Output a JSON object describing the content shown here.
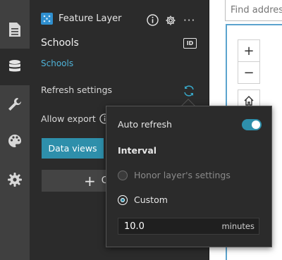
{
  "layer": {
    "type_label": "Feature Layer",
    "name": "Schools",
    "link": "Schools"
  },
  "settings": {
    "refresh_label": "Refresh settings",
    "allow_export_label": "Allow export",
    "data_views_label": "Data views",
    "create_button_label": "C"
  },
  "popover": {
    "auto_refresh_label": "Auto refresh",
    "auto_refresh_on": true,
    "interval_heading": "Interval",
    "options": [
      {
        "label": "Honor layer's settings",
        "selected": false
      },
      {
        "label": "Custom",
        "selected": true
      }
    ],
    "interval_value": "10.0",
    "interval_unit": "minutes"
  },
  "map": {
    "search_placeholder": "Find address",
    "zoom_in": "+",
    "zoom_out": "−"
  },
  "colors": {
    "accent": "#2e8fab",
    "link": "#4fb3d9",
    "panel": "#2b2b2b",
    "rail": "#404040"
  }
}
